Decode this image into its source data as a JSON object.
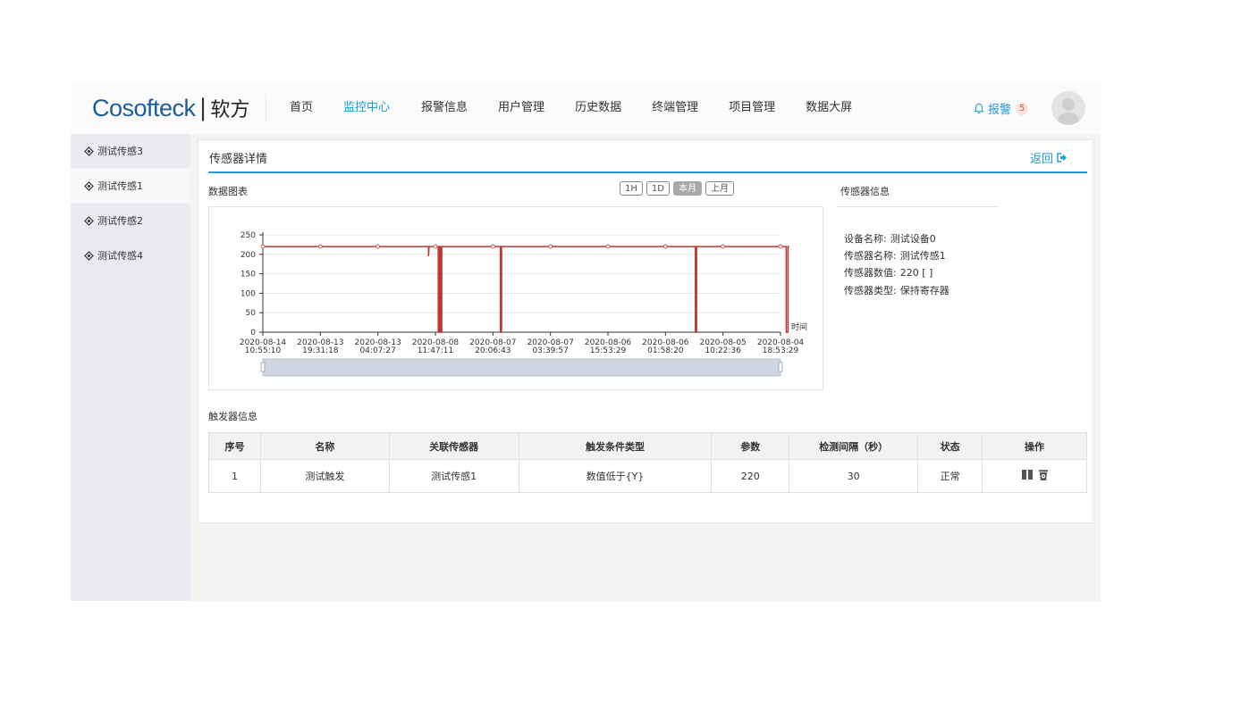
{
  "header": {
    "brand": "Cosofteck",
    "brand_sep": "|",
    "brand_cn": "软方",
    "nav": [
      "首页",
      "监控中心",
      "报警信息",
      "用户管理",
      "历史数据",
      "终端管理",
      "项目管理",
      "数据大屏"
    ],
    "active_nav": "监控中心",
    "alarm_label": "报警",
    "alarm_count": "5"
  },
  "sidebar": {
    "items": [
      {
        "label": "测试传感3"
      },
      {
        "label": "测试传感1"
      },
      {
        "label": "测试传感2"
      },
      {
        "label": "测试传感4"
      }
    ],
    "active": "测试传感1"
  },
  "panel": {
    "title": "传感器详情",
    "back_label": "返回",
    "chart_section": "数据图表",
    "range_buttons": [
      "1H",
      "1D",
      "本月",
      "上月"
    ],
    "active_range": "本月",
    "info_section": "传感器信息",
    "info": [
      {
        "key": "设备名称:",
        "value": "测试设备0"
      },
      {
        "key": "传感器名称:",
        "value": "测试传感1"
      },
      {
        "key": "传感器数值:",
        "value": "220 [ ]"
      },
      {
        "key": "传感器类型:",
        "value": "保持寄存器"
      }
    ],
    "trigger_section": "触发器信息"
  },
  "table": {
    "columns": [
      "序号",
      "名称",
      "关联传感器",
      "触发条件类型",
      "参数",
      "检测间隔（秒）",
      "状态",
      "操作"
    ],
    "rows": [
      {
        "no": "1",
        "name": "测试触发",
        "sensor": "测试传感1",
        "cond": "数值低于{Y}",
        "param": "220",
        "interval": "30",
        "status": "正常"
      }
    ]
  },
  "chart_data": {
    "type": "line",
    "xlabel": "时间",
    "ylim": [
      0,
      250
    ],
    "yticks": [
      0,
      50,
      100,
      150,
      200,
      250
    ],
    "xticks": [
      [
        "2020-08-14",
        "10:55:10"
      ],
      [
        "2020-08-13",
        "19:31:18"
      ],
      [
        "2020-08-13",
        "04:07:27"
      ],
      [
        "2020-08-08",
        "11:47:11"
      ],
      [
        "2020-08-07",
        "20:06:43"
      ],
      [
        "2020-08-07",
        "03:39:57"
      ],
      [
        "2020-08-06",
        "15:53:29"
      ],
      [
        "2020-08-06",
        "01:58:20"
      ],
      [
        "2020-08-05",
        "10:22:36"
      ],
      [
        "2020-08-04",
        "18:53:29"
      ]
    ],
    "series": [
      {
        "color": "#c23531",
        "points": [
          [
            0,
            220
          ],
          [
            1,
            220
          ],
          [
            2,
            220
          ],
          [
            2.88,
            220
          ],
          [
            2.88,
            195
          ],
          [
            2.89,
            220
          ],
          [
            3,
            220
          ],
          [
            3.05,
            220
          ],
          [
            3.05,
            0
          ],
          [
            3.07,
            0
          ],
          [
            3.07,
            220
          ],
          [
            3.09,
            220
          ],
          [
            3.09,
            0
          ],
          [
            3.11,
            0
          ],
          [
            3.11,
            220
          ],
          [
            4,
            220
          ],
          [
            4.13,
            220
          ],
          [
            4.13,
            0
          ],
          [
            4.15,
            0
          ],
          [
            4.15,
            220
          ],
          [
            5,
            220
          ],
          [
            6,
            220
          ],
          [
            7,
            220
          ],
          [
            7.52,
            220
          ],
          [
            7.52,
            0
          ],
          [
            7.54,
            0
          ],
          [
            7.54,
            220
          ],
          [
            8,
            220
          ],
          [
            9,
            220
          ],
          [
            9.1,
            220
          ],
          [
            9.1,
            0
          ],
          [
            9.13,
            0
          ],
          [
            9.13,
            220
          ],
          [
            9.15,
            220
          ]
        ],
        "markers": [
          0,
          1,
          2,
          3,
          4,
          5,
          6,
          7,
          8,
          9
        ]
      }
    ],
    "grid": true,
    "zoom_slider": true
  }
}
